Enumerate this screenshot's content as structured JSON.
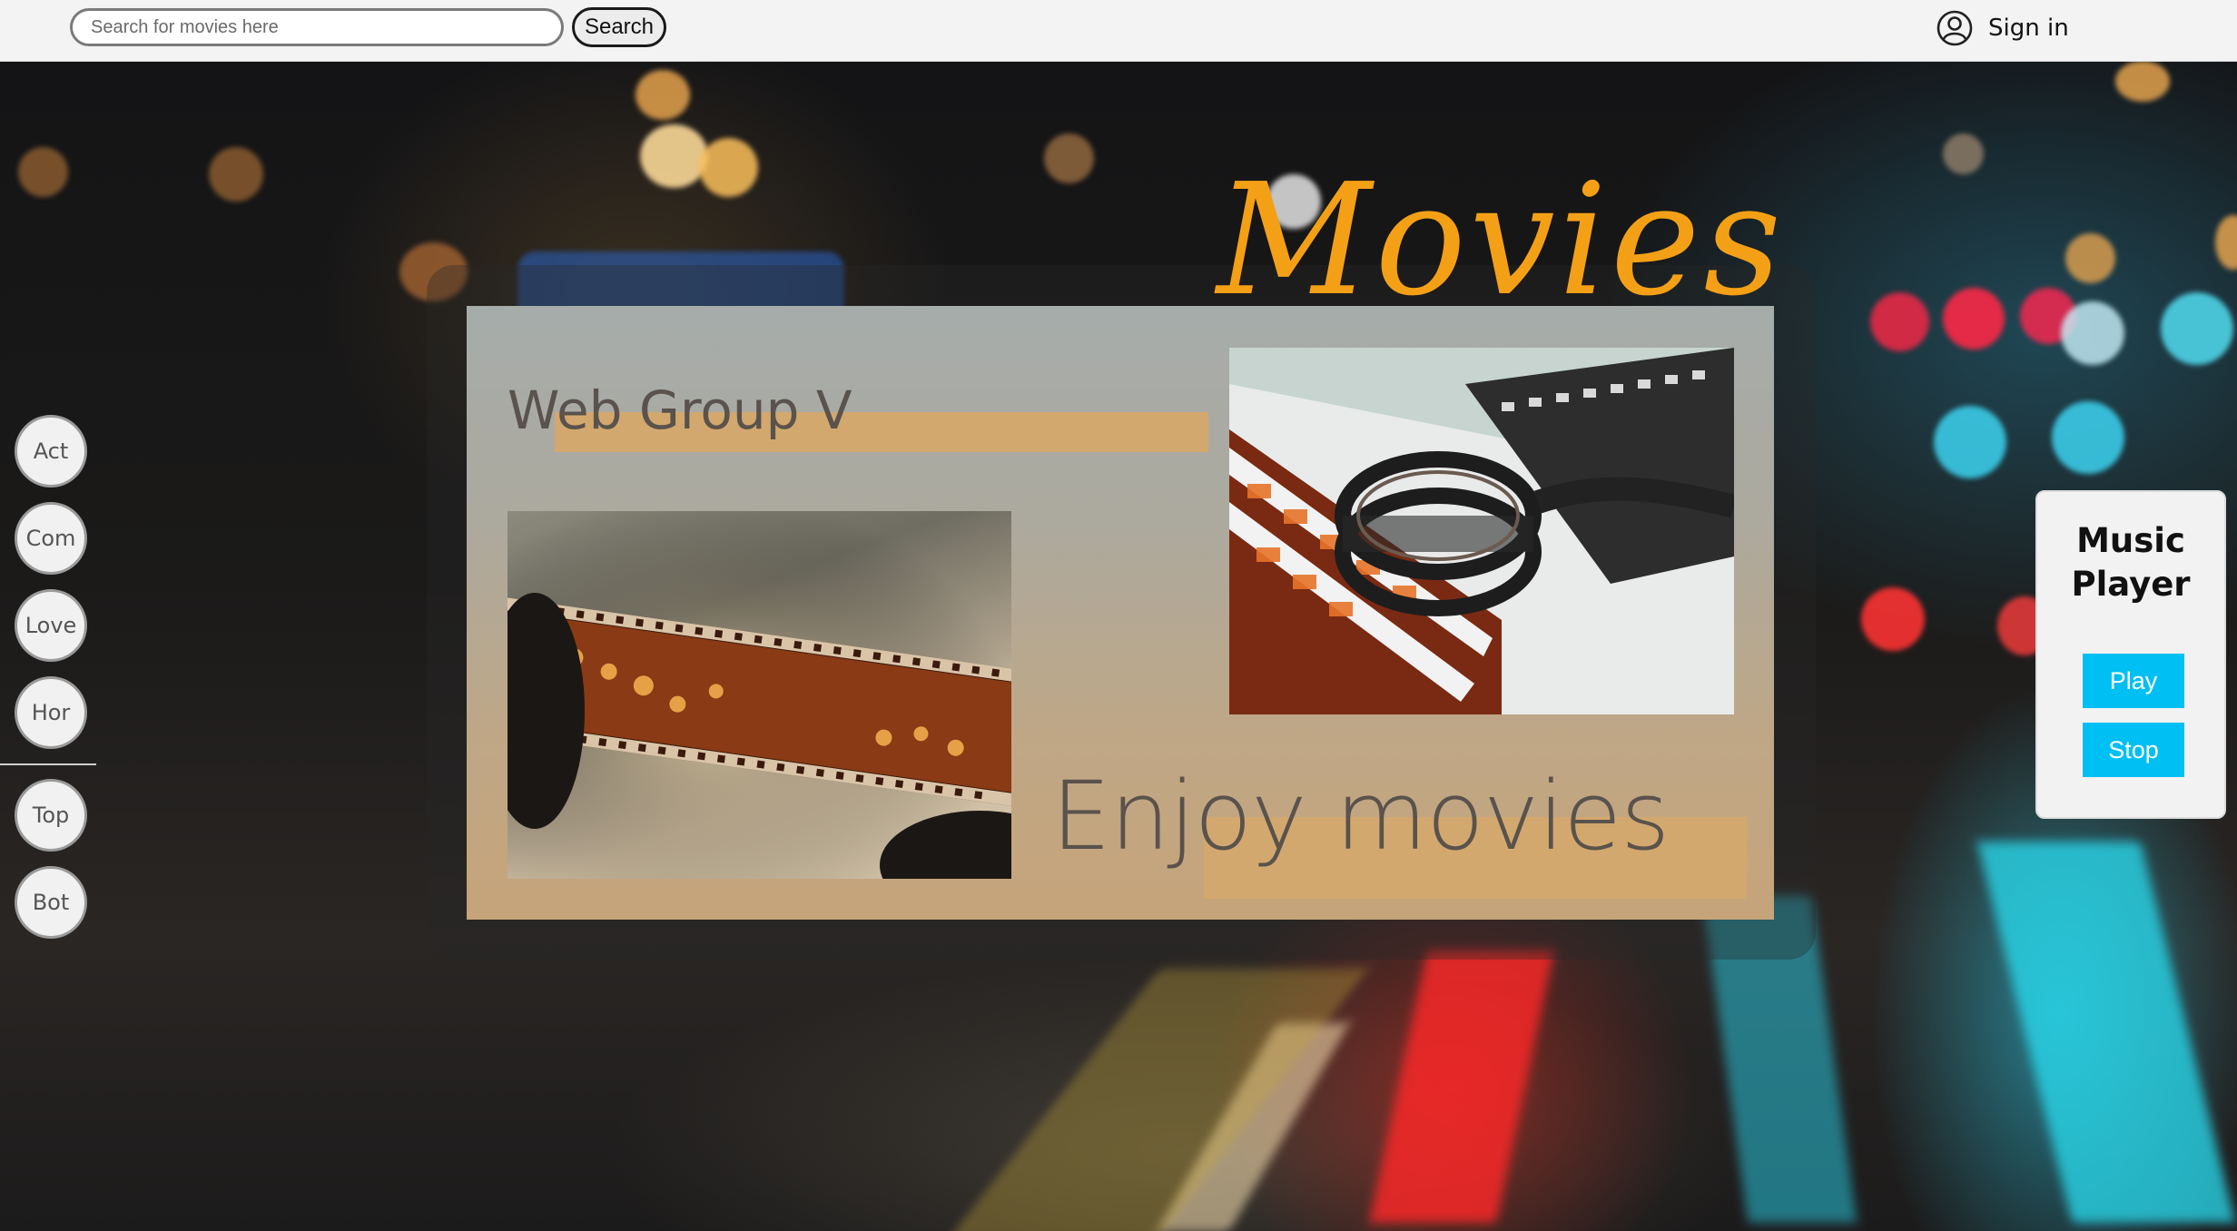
{
  "search": {
    "placeholder": "Search for movies here",
    "button_label": "Search"
  },
  "account": {
    "signin_label": "Sign in",
    "icon": "user-circle-icon"
  },
  "brand": {
    "logo_text": "Movies"
  },
  "hero": {
    "group_title": "Web Group V",
    "tagline": "Enjoy movies"
  },
  "genres": [
    "Act",
    "Com",
    "Love",
    "Hor"
  ],
  "scroll_nav": [
    "Top",
    "Bot"
  ],
  "music_player": {
    "title_line1": "Music",
    "title_line2": "Player",
    "play_label": "Play",
    "stop_label": "Stop"
  },
  "colors": {
    "accent": "#00BFF2",
    "logo": "#F4A017",
    "highlight": "#D3A86E"
  }
}
